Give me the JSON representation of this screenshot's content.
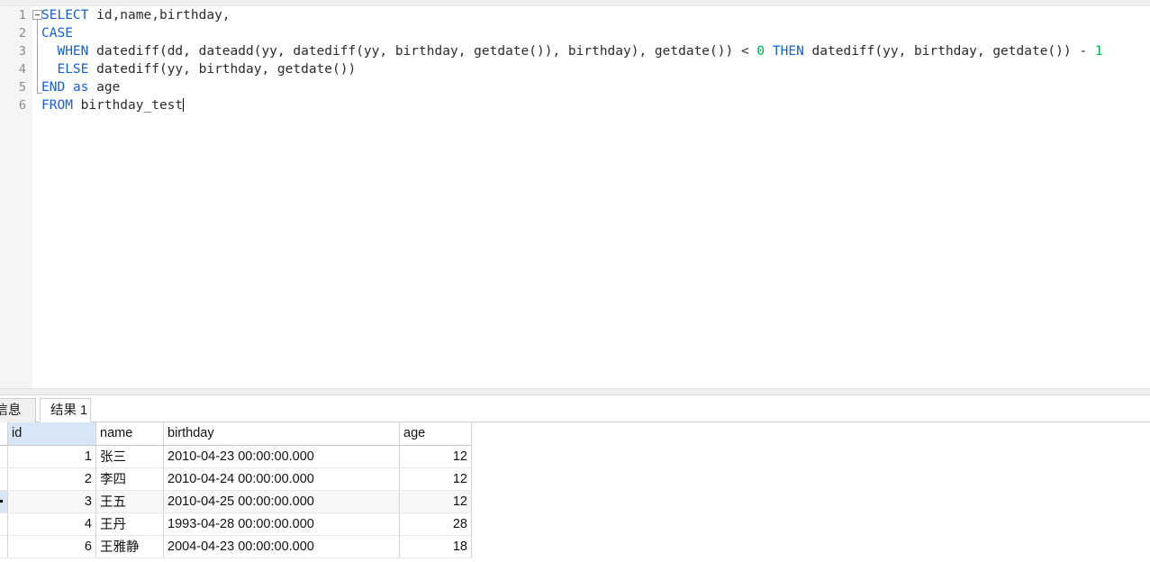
{
  "editor": {
    "lines": [
      {
        "number": "1",
        "tokens": [
          {
            "t": "SELECT",
            "c": "kw"
          },
          {
            "t": " id,name,birthday,",
            "c": "plain"
          }
        ]
      },
      {
        "number": "2",
        "tokens": [
          {
            "t": "CASE",
            "c": "kw"
          }
        ]
      },
      {
        "number": "3",
        "tokens": [
          {
            "t": "  ",
            "c": "plain"
          },
          {
            "t": "WHEN",
            "c": "kw"
          },
          {
            "t": " datediff(dd, dateadd(yy, datediff(yy, birthday, getdate()), birthday), getdate()) < ",
            "c": "plain"
          },
          {
            "t": "0",
            "c": "num"
          },
          {
            "t": " ",
            "c": "plain"
          },
          {
            "t": "THEN",
            "c": "kw"
          },
          {
            "t": " datediff(yy, birthday, getdate()) - ",
            "c": "plain"
          },
          {
            "t": "1",
            "c": "num"
          }
        ]
      },
      {
        "number": "4",
        "tokens": [
          {
            "t": "  ",
            "c": "plain"
          },
          {
            "t": "ELSE",
            "c": "kw"
          },
          {
            "t": " datediff(yy, birthday, getdate())",
            "c": "plain"
          }
        ]
      },
      {
        "number": "5",
        "tokens": [
          {
            "t": "END",
            "c": "kw"
          },
          {
            "t": " ",
            "c": "plain"
          },
          {
            "t": "as",
            "c": "kw"
          },
          {
            "t": " age",
            "c": "plain"
          }
        ]
      },
      {
        "number": "6",
        "tokens": [
          {
            "t": "FROM",
            "c": "kw"
          },
          {
            "t": " birthday_test",
            "c": "plain"
          }
        ]
      }
    ],
    "fold_state": "expanded"
  },
  "results": {
    "tabs": [
      {
        "label": "信息",
        "active": false
      },
      {
        "label": "结果 1",
        "active": true
      }
    ],
    "columns": [
      {
        "key": "id",
        "label": "id",
        "align": "right",
        "selected": true
      },
      {
        "key": "name",
        "label": "name",
        "align": "left",
        "selected": false
      },
      {
        "key": "birthday",
        "label": "birthday",
        "align": "left",
        "selected": false
      },
      {
        "key": "age",
        "label": "age",
        "align": "right",
        "selected": false
      }
    ],
    "rows": [
      {
        "id": "1",
        "name": "张三",
        "birthday": "2010-04-23 00:00:00.000",
        "age": "12",
        "current": false
      },
      {
        "id": "2",
        "name": "李四",
        "birthday": "2010-04-24 00:00:00.000",
        "age": "12",
        "current": false
      },
      {
        "id": "3",
        "name": "王五",
        "birthday": "2010-04-25 00:00:00.000",
        "age": "12",
        "current": true
      },
      {
        "id": "4",
        "name": "王丹",
        "birthday": "1993-04-28 00:00:00.000",
        "age": "28",
        "current": false
      },
      {
        "id": "6",
        "name": "王雅静",
        "birthday": "2004-04-23 00:00:00.000",
        "age": "18",
        "current": false
      }
    ]
  },
  "colors": {
    "keyword": "#1560d0",
    "number_literal": "#00b050",
    "plain_text": "#2b2b2b",
    "gutter_bg": "#f5f5f5",
    "line_number": "#8a8a8a",
    "selected_header": "#d6e6f7",
    "current_row": "#f7f7f7"
  }
}
